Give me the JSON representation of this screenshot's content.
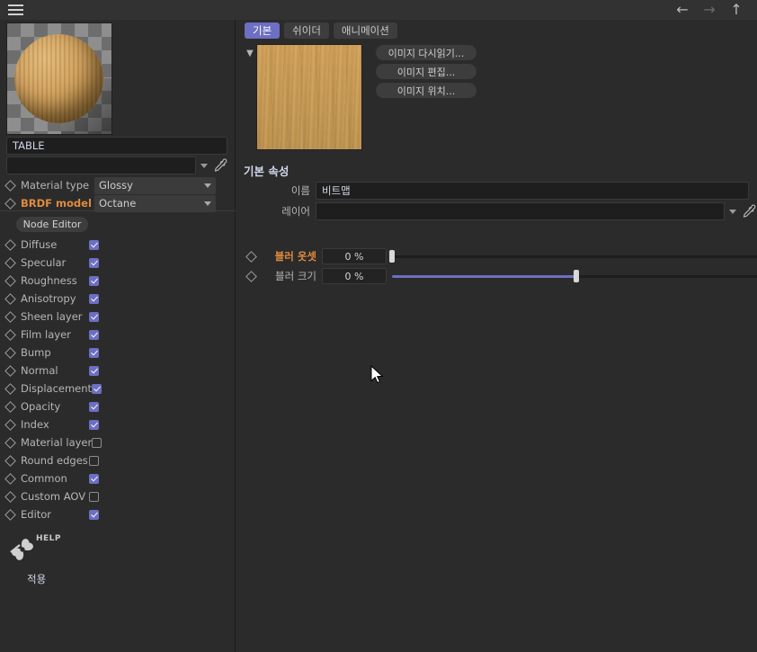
{
  "topbar": {
    "menu_icon": "hamburger-icon",
    "nav": [
      {
        "name": "back-arrow-icon",
        "glyph": "←",
        "state": "enabled"
      },
      {
        "name": "forward-arrow-icon",
        "glyph": "→",
        "state": "disabled"
      },
      {
        "name": "up-arrow-icon",
        "glyph": "↑",
        "state": "enabled"
      }
    ]
  },
  "sidebar": {
    "material_name": "TABLE",
    "layer_value": "",
    "properties": [
      {
        "label": "Material type",
        "value": "Glossy",
        "highlighted": false
      },
      {
        "label": "BRDF model",
        "value": "Octane",
        "highlighted": true
      }
    ],
    "node_editor_label": "Node Editor",
    "channels": [
      {
        "label": "Diffuse",
        "checked": true
      },
      {
        "label": "Specular",
        "checked": true
      },
      {
        "label": "Roughness",
        "checked": true
      },
      {
        "label": "Anisotropy",
        "checked": true
      },
      {
        "label": "Sheen layer",
        "checked": true
      },
      {
        "label": "Film layer",
        "checked": true
      },
      {
        "label": "Bump",
        "checked": true
      },
      {
        "label": "Normal",
        "checked": true
      },
      {
        "label": "Displacement",
        "checked": true
      },
      {
        "label": "Opacity",
        "checked": true
      },
      {
        "label": "Index",
        "checked": true
      },
      {
        "label": "Material layer",
        "checked": false
      },
      {
        "label": "Round edges",
        "checked": false
      },
      {
        "label": "Common",
        "checked": true
      },
      {
        "label": "Custom AOV",
        "checked": false
      },
      {
        "label": "Editor",
        "checked": true
      }
    ],
    "help_label": "HELP",
    "apply_label": "적용"
  },
  "main": {
    "tabs": [
      {
        "label": "기본",
        "active": true
      },
      {
        "label": "쉬이더",
        "active": false
      },
      {
        "label": "애니메이션",
        "active": false
      }
    ],
    "image_buttons": [
      "이미지 다시읽기...",
      "이미지 편집...",
      "이미지 위치..."
    ],
    "section_title": "기본 속성",
    "fields": [
      {
        "label": "이름",
        "value": "비트맵"
      },
      {
        "label": "레이어",
        "value": ""
      }
    ],
    "sliders": [
      {
        "label": "블러 옷셋",
        "value": "0 %",
        "percent": 0,
        "highlighted": true
      },
      {
        "label": "블러 크기",
        "value": "0 %",
        "percent": 50,
        "highlighted": false
      }
    ]
  },
  "colors": {
    "accent": "#6c6fc2",
    "highlight_text": "#e08b3c",
    "panel_bg": "#2b2b2b",
    "topbar_bg": "#323232",
    "field_bg": "#1e1e1e"
  }
}
